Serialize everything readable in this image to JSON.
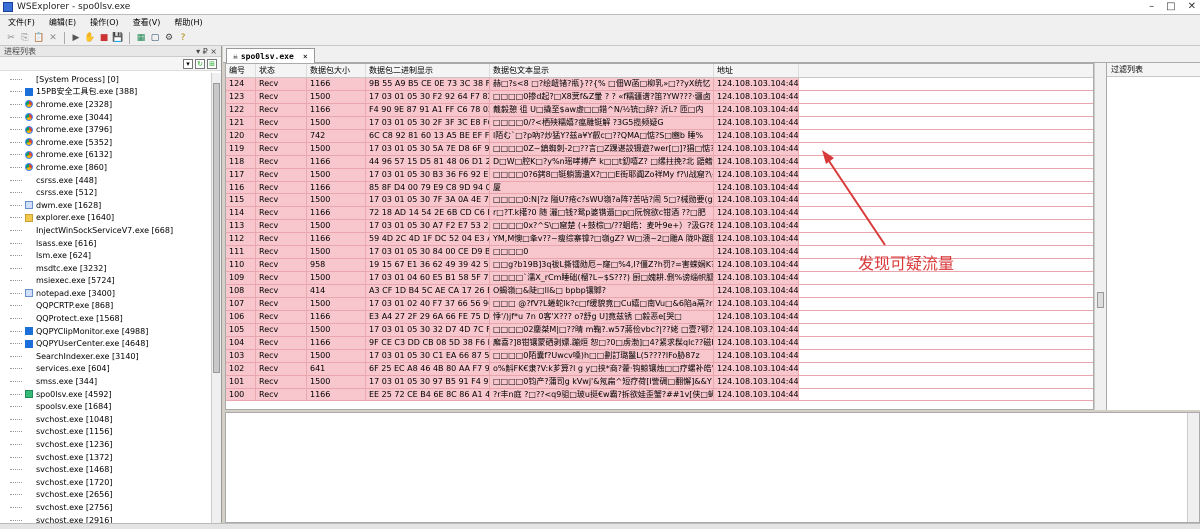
{
  "window": {
    "title": "WSExplorer - spo0lsv.exe",
    "minimize": "–",
    "maximize": "□",
    "close": "✕"
  },
  "menu": [
    "文件(F)",
    "编辑(E)",
    "操作(O)",
    "查看(V)",
    "帮助(H)"
  ],
  "left_panel": {
    "header": "进程列表",
    "pin": "▾ ₽ ×"
  },
  "processes": [
    {
      "name": "[System Process] [0]",
      "icon": "none"
    },
    {
      "name": "15PB安全工具包.exe [388]",
      "icon": "blue"
    },
    {
      "name": "chrome.exe [2328]",
      "icon": "chrome"
    },
    {
      "name": "chrome.exe [3044]",
      "icon": "chrome"
    },
    {
      "name": "chrome.exe [3796]",
      "icon": "chrome"
    },
    {
      "name": "chrome.exe [5352]",
      "icon": "chrome"
    },
    {
      "name": "chrome.exe [6132]",
      "icon": "chrome"
    },
    {
      "name": "chrome.exe [860]",
      "icon": "chrome"
    },
    {
      "name": "csrss.exe [448]",
      "icon": "none"
    },
    {
      "name": "csrss.exe [512]",
      "icon": "none"
    },
    {
      "name": "dwm.exe [1628]",
      "icon": "app"
    },
    {
      "name": "explorer.exe [1640]",
      "icon": "folder"
    },
    {
      "name": "InjectWinSockServiceV7.exe [668]",
      "icon": "none"
    },
    {
      "name": "lsass.exe [616]",
      "icon": "none"
    },
    {
      "name": "lsm.exe [624]",
      "icon": "none"
    },
    {
      "name": "msdtc.exe [3232]",
      "icon": "none"
    },
    {
      "name": "msiexec.exe [5724]",
      "icon": "none"
    },
    {
      "name": "notepad.exe [3400]",
      "icon": "app"
    },
    {
      "name": "QQPCRTP.exe [868]",
      "icon": "none"
    },
    {
      "name": "QQProtect.exe [1568]",
      "icon": "none"
    },
    {
      "name": "QQPYClipMonitor.exe [4988]",
      "icon": "blue"
    },
    {
      "name": "QQPYUserCenter.exe [4648]",
      "icon": "blue"
    },
    {
      "name": "SearchIndexer.exe [3140]",
      "icon": "none"
    },
    {
      "name": "services.exe [604]",
      "icon": "none"
    },
    {
      "name": "smss.exe [344]",
      "icon": "none"
    },
    {
      "name": "spo0lsv.exe [4592]",
      "icon": "sel"
    },
    {
      "name": "spoolsv.exe [1684]",
      "icon": "none"
    },
    {
      "name": "svchost.exe [1048]",
      "icon": "none"
    },
    {
      "name": "svchost.exe [1156]",
      "icon": "none"
    },
    {
      "name": "svchost.exe [1236]",
      "icon": "none"
    },
    {
      "name": "svchost.exe [1372]",
      "icon": "none"
    },
    {
      "name": "svchost.exe [1468]",
      "icon": "none"
    },
    {
      "name": "svchost.exe [1720]",
      "icon": "none"
    },
    {
      "name": "svchost.exe [2656]",
      "icon": "none"
    },
    {
      "name": "svchost.exe [2756]",
      "icon": "none"
    },
    {
      "name": "svchost.exe [2916]",
      "icon": "none"
    }
  ],
  "tab": {
    "label": "spo0lsv.exe",
    "close": "×"
  },
  "columns": [
    "编号",
    "状态",
    "数据包大小",
    "数据包二进制显示",
    "数据包文本显示",
    "地址"
  ],
  "filter_header": "过滤列表",
  "rows": [
    [
      "124",
      "Recv",
      "1166",
      "9B 55 A9 B5 CE 0E 73 3C 38 F...",
      "赫□?s<8 □?绘衄锗?瓶}??{% □佃W菡□柳乳»□??yX统忆",
      "124.108.103.104:443"
    ],
    [
      "123",
      "Recv",
      "1500",
      "17 03 01 05 30 F2 92 64 F7 82 ...",
      "□□□□0掺d起?□X8蓂f&Z暈 ? ? «f糯疆谱?笛?YW???·疆卤",
      "124.108.103.104:443"
    ],
    [
      "122",
      "Recv",
      "1166",
      "F4 90 9E 87 91 A1 FF C6 78 02 ...",
      "戴毅憩 徂 U□撬至$aw虚□□錯^N/½铳□辞? 沂L? 匝□内",
      "124.108.103.104:443"
    ],
    [
      "121",
      "Recv",
      "1500",
      "17 03 01 05 30 2F 3F 3C E8 F6 ...",
      "□□□□0/?<栖殃糯嬉?瘟雕铤解 ?3G5揽频疑G",
      "124.108.103.104:443"
    ],
    [
      "120",
      "Recv",
      "742",
      "6C C8 92 81 60 13 A5 BE EF FF...",
      "l陌む`□?p吶?炒猛Y?兹a¥Y叡c□??QMA□惦?S□豳b 睡%",
      "124.108.103.104:443"
    ],
    [
      "119",
      "Recv",
      "1500",
      "17 03 01 05 30 5A 7E D8 6F 9E...",
      "□□□□0Z~鎮蜘刺-2□??言□Z踝谌詨镊遊?wer[□]?猖□惦?辅G",
      "124.108.103.104:443"
    ],
    [
      "118",
      "Recv",
      "1166",
      "44 96 57 15 D5 81 48 06 D1 2...",
      "D□W□腔K□?y%n瑶哮搏产 k□□t釖嘻Z? □缧拄挽?北 鼯鳍",
      "124.108.103.104:443"
    ],
    [
      "117",
      "Recv",
      "1500",
      "17 03 01 05 30 B3 36 F6 92 E7...",
      "□□□□0?6銬8□铤躺籌遺X?□□E街耶阗Zo祥My f?\\l战窟?\\+",
      "124.108.103.104:443"
    ],
    [
      "116",
      "Recv",
      "1166",
      "85 8F D4 00 79 E9 C8 9D 94 0...",
      "厦",
      "124.108.103.104:443"
    ],
    [
      "115",
      "Recv",
      "1500",
      "17 03 01 05 30 7F 3A 0A 4E 7C...",
      "□□□□0:N|?z 隘U?疮c?sWU嶺?a阵?苦呫?闹 5□?械勋要(g",
      "124.108.103.104:443"
    ],
    [
      "114",
      "Recv",
      "1166",
      "72 18 AD 14 54 2E 6B CD C6 E...",
      "r□?T.k擆?0 随 灑□钱?鸳p婆镌遢□p□阮惋欲c钳酒 ??□肥",
      "124.108.103.104:443"
    ],
    [
      "113",
      "Recv",
      "1500",
      "17 03 01 05 30 A7 F2 E7 53 28...",
      "□□□□0x?^S\\□窟楚 (+鼓棕□/??蛔皓：麦叶9e+）?汲G?8敲",
      "124.108.103.104:443"
    ],
    [
      "112",
      "Recv",
      "1166",
      "59 4D 2C 4D 1F DC 52 04 E3 A...",
      "YM,M懊□夆v??~瘦综寨镎?□嶺gZ? W□溃~2□雕A 陇卟踞膘",
      "124.108.103.104:443"
    ],
    [
      "111",
      "Recv",
      "1500",
      "17 03 01 05 30 84 00 CE D9 B...",
      "□□□□0",
      "124.108.103.104:443"
    ],
    [
      "110",
      "Recv",
      "958",
      "19 15 67 E1 36 62 49 39 42 5D...",
      "□□g?b19B]3q祓L撕镭勋厄~窿□%4,I?僵Z?h罚?=害蝾娴K?祈",
      "124.108.103.104:443"
    ],
    [
      "109",
      "Recv",
      "1500",
      "17 03 01 04 60 E5 B1 58 5F 72...",
      "□□□□`濡X_rCm睡础(榴?L~$S???) 厨□媿耕.侀%谤缁帜胍嘉",
      "124.108.103.104:443"
    ],
    [
      "108",
      "Recv",
      "414",
      "A3 CF 1D B4 5C AE CA 17 26 E...",
      "O蝎嶺□&陡□ll&□ bpbp镶鄹?",
      "124.108.103.104:443"
    ],
    [
      "107",
      "Recv",
      "1500",
      "17 03 01 02 40 F7 37 66 56 90 ...",
      "□□□ @?fV?L蜷蛇lk?c□f缓貌竟□Cu嬉□南Vu□&6陷a鬲?ri3kt",
      "124.108.103.104:443"
    ],
    [
      "106",
      "Recv",
      "1166",
      "E3 A4 27 2F 29 6A 66 FE 75 DB...",
      "悸'/)jf*u 7n 0客'X??? o?舒g U]竟兹锈 □毅恶e[哭□",
      "124.108.103.104:443"
    ],
    [
      "105",
      "Recv",
      "1500",
      "17 03 01 05 30 32 D7 4D 7C F...",
      "□□□□02鏖桀M|□??晴 m鞠?.w57蔣俭vbc?|??姥 □壹?鄂?刊?",
      "124.108.103.104:443"
    ],
    [
      "104",
      "Recv",
      "1166",
      "9F CE C3 DD CB 08 5D 38 F6 E...",
      "廨喜?]8钳镶蒙硒剥嫖.蹦烜 恕□?0□虏渤]□4?紧求髹qlc??磁K□",
      "124.108.103.104:443"
    ],
    [
      "103",
      "Recv",
      "1500",
      "17 03 01 05 30 C1 EA 66 87 55...",
      "□□□□0陌囊f?Uwcv嗓)h□□劃訂璐鬣L(5????lFo胁87z",
      "124.108.103.104:443"
    ],
    [
      "102",
      "Recv",
      "641",
      "6F 25 EC A8 46 4B 80 AA F7 9...",
      "o%斛FK€隶?V:k芗算?l g y□挟*商?藿·钩鲸镶烛□□疗螺补皓\"3",
      "124.108.103.104:443"
    ],
    [
      "101",
      "Recv",
      "1500",
      "17 03 01 05 30 97 B5 91 F4 9D...",
      "□□□□0钧产?蒲司g kVwj'&氖扁^短疗荷[I訾碉□翻懈]&&Y",
      "124.108.103.104:443"
    ],
    [
      "100",
      "Recv",
      "1166",
      "EE 25 72 CE B4 6E 8C 86 A1 4F...",
      "?r丰n庭 ?□??<q9驵□玻u挺€w霸?拆欲娃歪蟹?##1v[侠□蝇奁",
      "124.108.103.104:443"
    ]
  ],
  "annotation": "发现可疑流量",
  "status_text": "",
  "colors": {
    "row_highlight": "#f7c7cd",
    "annotation": "#d83a3a"
  }
}
